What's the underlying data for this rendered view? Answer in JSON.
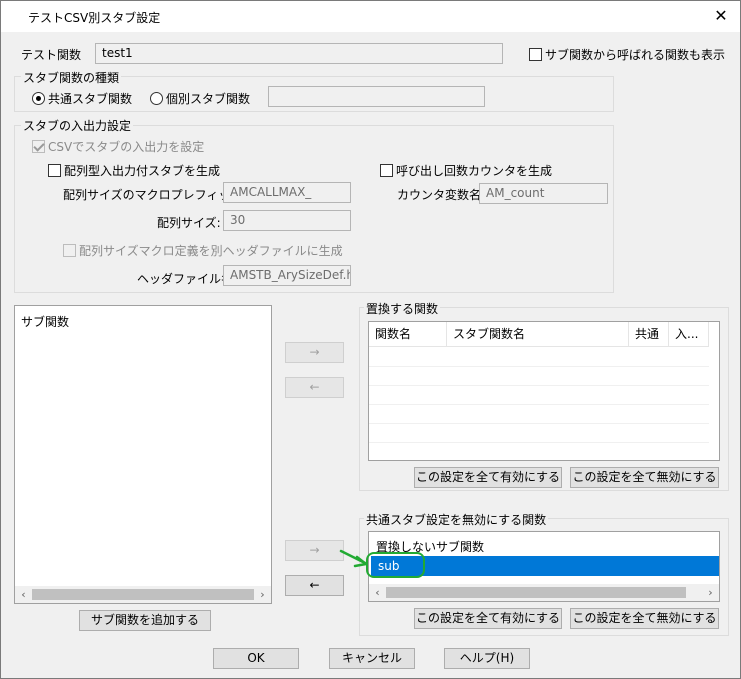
{
  "window": {
    "title": "テストCSV別スタブ設定",
    "close_glyph": "✕"
  },
  "test_function": {
    "label": "テスト関数",
    "value": "test1"
  },
  "show_sub_called": {
    "label": "サブ関数から呼ばれる関数も表示",
    "checked": false
  },
  "stub_kind": {
    "title": "スタブ関数の種類",
    "common_label": "共通スタブ関数",
    "individual_label": "個別スタブ関数",
    "individual_value": ""
  },
  "stub_io": {
    "title": "スタブの入出力設定",
    "csv_label": "CSVでスタブの入出力を設定",
    "array_stub_label": "配列型入出力付スタブを生成",
    "call_counter_label": "呼び出し回数カウンタを生成",
    "macro_prefix_label": "配列サイズのマクロプレフィックス:",
    "macro_prefix_value": "AMCALLMAX_",
    "counter_var_label": "カウンタ変数名:",
    "counter_var_value": "AM_count",
    "array_size_label": "配列サイズ:",
    "array_size_value": "30",
    "macro_header_label": "配列サイズマクロ定義を別ヘッダファイルに生成",
    "header_file_label": "ヘッダファイル名:",
    "header_file_value": "AMSTB_ArySizeDef.h"
  },
  "sub_functions": {
    "header": "サブ関数",
    "add_button": "サブ関数を追加する"
  },
  "arrows": {
    "right": "→",
    "left": "←",
    "scroll_left": "‹",
    "scroll_right": "›"
  },
  "replace_functions": {
    "title": "置換する関数",
    "columns": [
      "関数名",
      "スタブ関数名",
      "共通",
      "入..."
    ],
    "enable_all": "この設定を全て有効にする",
    "disable_all": "この設定を全て無効にする"
  },
  "disable_common": {
    "title": "共通スタブ設定を無効にする関数",
    "list_header": "置換しないサブ関数",
    "items": [
      "sub"
    ],
    "enable_all": "この設定を全て有効にする",
    "disable_all": "この設定を全て無効にする"
  },
  "footer": {
    "ok": "OK",
    "cancel": "キャンセル",
    "help": "ヘルプ(H)"
  },
  "colors": {
    "selection": "#0078d7",
    "annotation": "#22aa33"
  }
}
